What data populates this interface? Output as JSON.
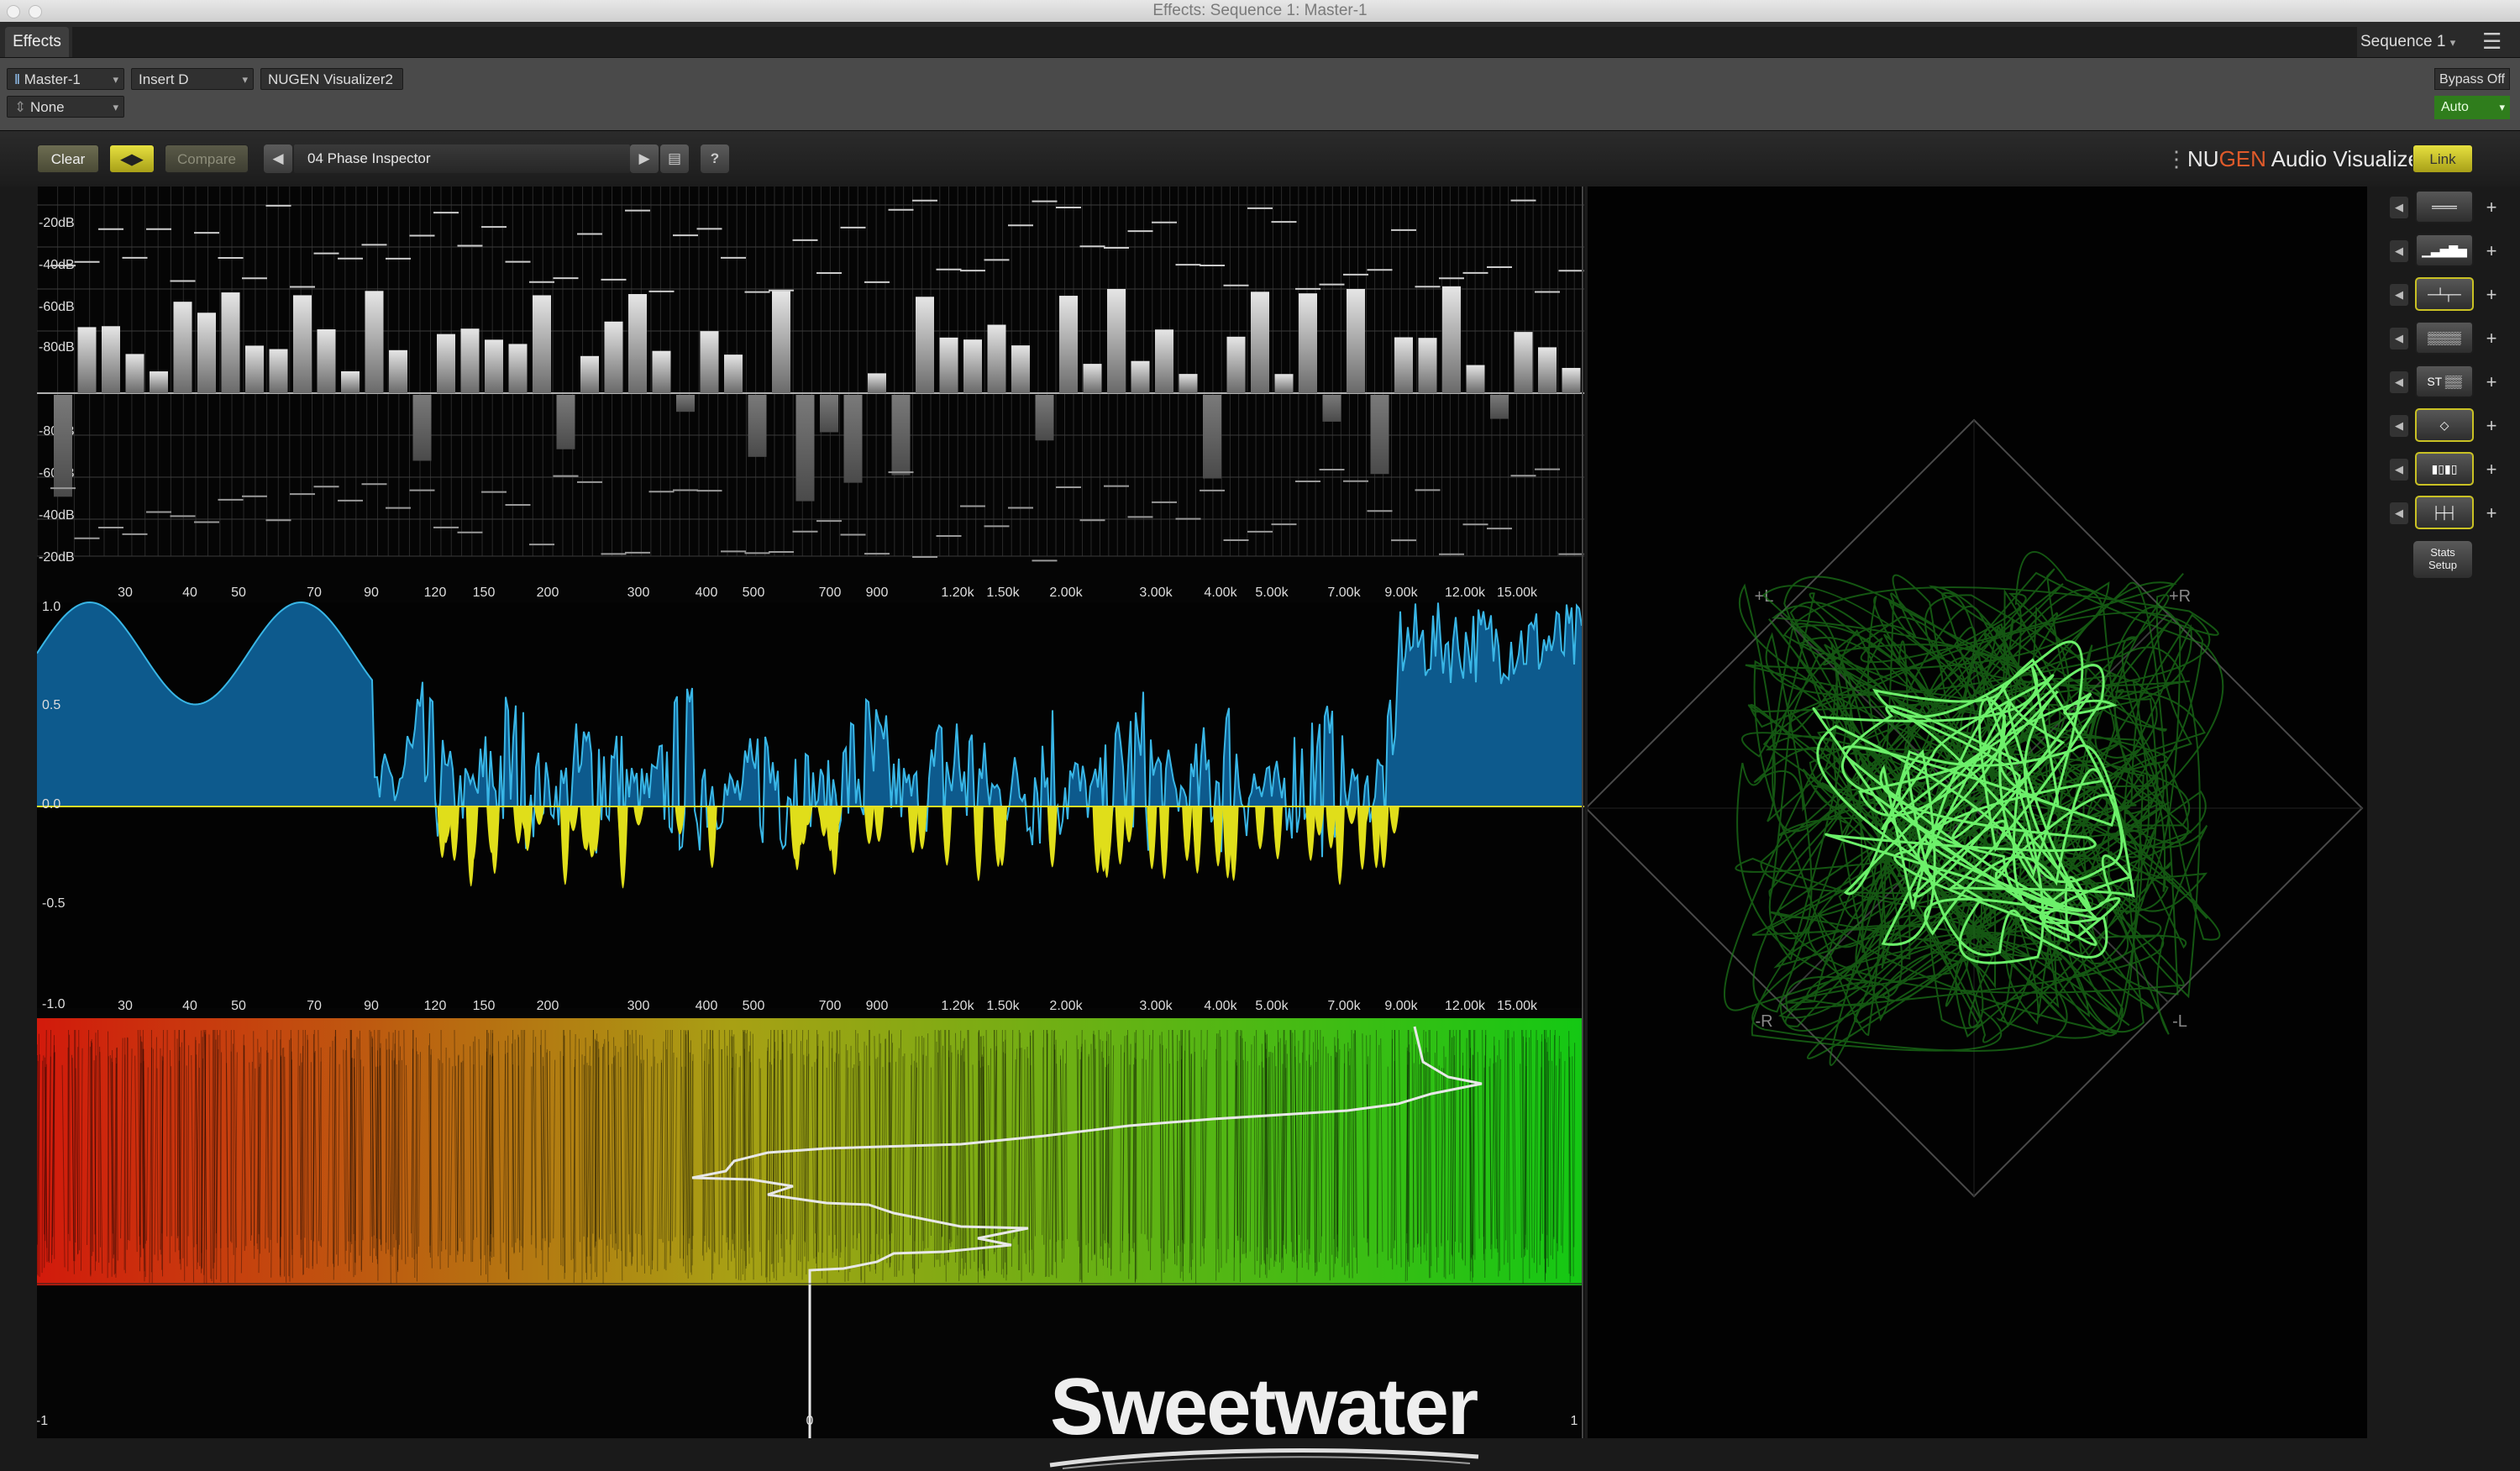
{
  "window": {
    "title": "Effects: Sequence 1: Master-1"
  },
  "header": {
    "tab": "Effects",
    "sequence": "Sequence 1"
  },
  "controls": {
    "track": "Master-1",
    "insert": "Insert D",
    "plugin_name": "NUGEN Visualizer2",
    "preset_source": "None",
    "bypass": "Bypass Off",
    "automation": "Auto"
  },
  "toolbar": {
    "clear": "Clear",
    "compare": "Compare",
    "preset": "04 Phase Inspector",
    "help": "?",
    "brand_nu": "NU",
    "brand_gen": "GEN",
    "brand_rest": " Audio Visualizer",
    "link": "Link"
  },
  "spectrum": {
    "db_labels_top": [
      "-20dB",
      "-40dB",
      "-60dB",
      "-80dB"
    ],
    "db_labels_bottom": [
      "-80dB",
      "-60dB",
      "-40dB",
      "-20dB"
    ],
    "freq_labels": [
      "30",
      "40",
      "50",
      "70",
      "90",
      "120",
      "150",
      "200",
      "300",
      "400",
      "500",
      "700",
      "900",
      "1.20k",
      "1.50k",
      "2.00k",
      "3.00k",
      "4.00k",
      "5.00k",
      "7.00k",
      "9.00k",
      "12.00k",
      "15.00k"
    ]
  },
  "correlation": {
    "labels": [
      "1.0",
      "0.5",
      "0.0",
      "-0.5",
      "-1.0"
    ]
  },
  "balance": {
    "labels": [
      "-1",
      "0",
      "1"
    ]
  },
  "vectorscope": {
    "labels": [
      "+L",
      "+R",
      "-R",
      "-L"
    ]
  },
  "side_buttons": [
    {
      "icon": "mode-lines-icon",
      "active": false
    },
    {
      "icon": "spectrum-bars-icon",
      "active": false
    },
    {
      "icon": "phase-spectrum-icon",
      "active": true
    },
    {
      "icon": "spectrogram-icon",
      "active": false
    },
    {
      "icon": "stereo-spectrum-icon",
      "label": "ST",
      "active": false
    },
    {
      "icon": "vectorscope-icon",
      "active": true
    },
    {
      "icon": "correlation-meter-icon",
      "active": true
    },
    {
      "icon": "balance-meter-icon",
      "active": true
    }
  ],
  "stats": "Stats\nSetup",
  "watermark": "Sweetwater"
}
